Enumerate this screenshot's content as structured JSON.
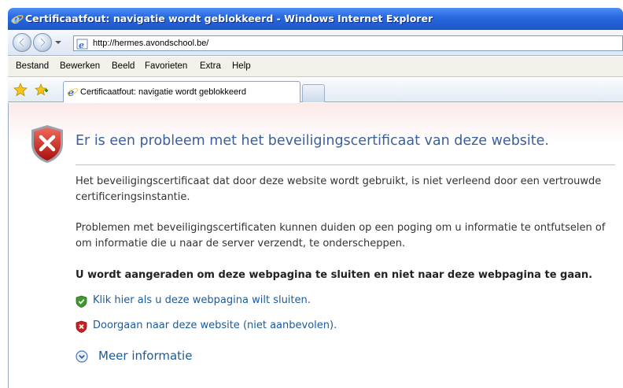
{
  "window": {
    "title": "Certificaatfout: navigatie wordt geblokkeerd - Windows Internet Explorer"
  },
  "address_bar": {
    "url": "http://hermes.avondschool.be/"
  },
  "menu": {
    "items": [
      "Bestand",
      "Bewerken",
      "Beeld",
      "Favorieten",
      "Extra",
      "Help"
    ]
  },
  "tabs": {
    "active_label": "Certificaatfout: navigatie wordt geblokkeerd"
  },
  "page": {
    "heading": "Er is een probleem met het beveiligingscertificaat van deze website.",
    "paragraph1": "Het beveiligingscertificaat dat door deze website wordt gebruikt, is niet verleend door een vertrouwde certificeringsinstantie.",
    "paragraph2": "Problemen met beveiligingscertificaten kunnen duiden op een poging om u informatie te ontfutselen of om informatie die u naar de server verzendt, te onderscheppen.",
    "recommendation": "U wordt aangeraden om deze webpagina te sluiten en niet naar deze webpagina te gaan.",
    "close_link": "Klik hier als u deze webpagina wilt sluiten.",
    "continue_link": "Doorgaan naar deze website (niet aanbevolen).",
    "more_info": "Meer informatie"
  },
  "colors": {
    "heading": "#3a5f9c",
    "link": "#1b5a9c",
    "shield_red": "#c8201e",
    "shield_green": "#3c9a2a"
  }
}
